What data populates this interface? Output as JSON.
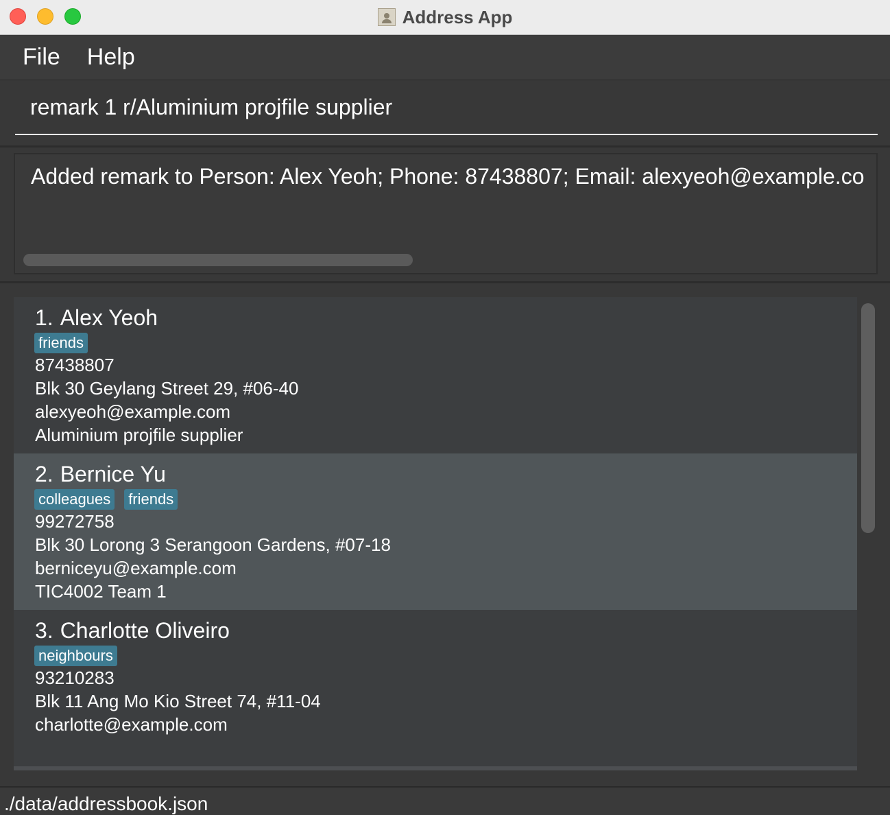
{
  "window": {
    "title": "Address App"
  },
  "menu": {
    "file": "File",
    "help": "Help"
  },
  "command": {
    "value": "remark 1 r/Aluminium projfile supplier"
  },
  "result": {
    "text": "Added remark to Person: Alex Yeoh; Phone: 87438807; Email: alexyeoh@example.co"
  },
  "persons": [
    {
      "index": "1.",
      "name": "Alex Yeoh",
      "tags": [
        "friends"
      ],
      "phone": "87438807",
      "address": "Blk 30 Geylang Street 29, #06-40",
      "email": "alexyeoh@example.com",
      "remark": "Aluminium projfile supplier"
    },
    {
      "index": "2.",
      "name": "Bernice Yu",
      "tags": [
        "colleagues",
        "friends"
      ],
      "phone": "99272758",
      "address": "Blk 30 Lorong 3 Serangoon Gardens, #07-18",
      "email": "berniceyu@example.com",
      "remark": "TIC4002 Team 1"
    },
    {
      "index": "3.",
      "name": "Charlotte Oliveiro",
      "tags": [
        "neighbours"
      ],
      "phone": "93210283",
      "address": "Blk 11 Ang Mo Kio Street 74, #11-04",
      "email": "charlotte@example.com",
      "remark": ""
    }
  ],
  "status": {
    "path": "./data/addressbook.json"
  },
  "colors": {
    "tag": "#3e7b91",
    "selected_row": "#505659",
    "background": "#383838"
  }
}
